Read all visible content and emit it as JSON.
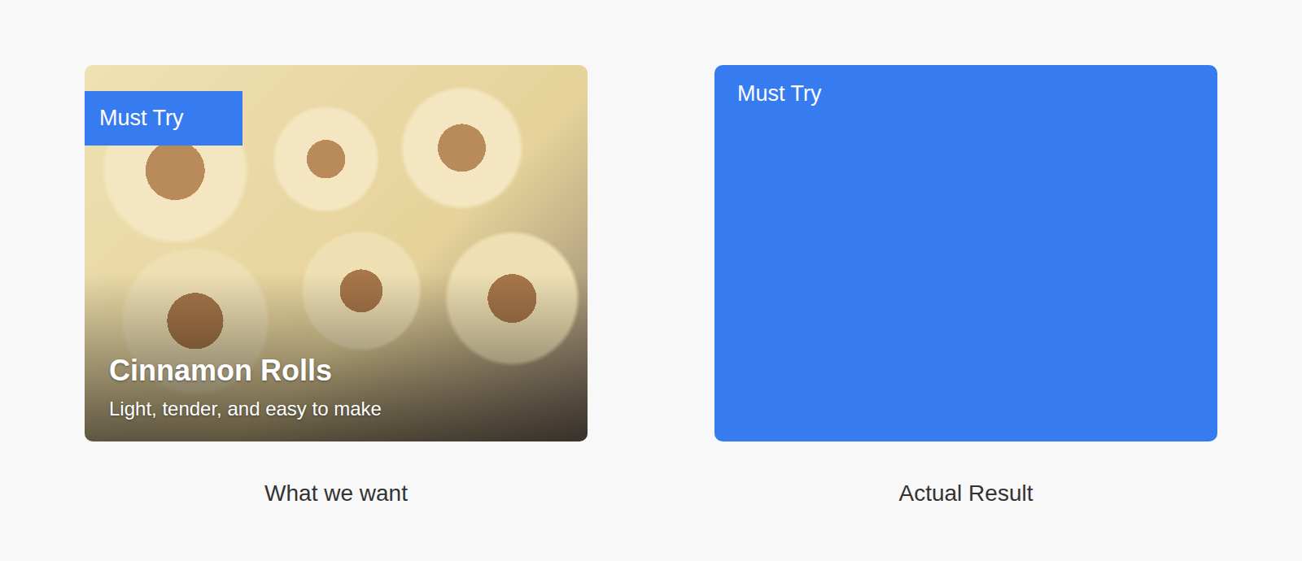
{
  "cards": [
    {
      "kind": "photo",
      "badge": "Must Try",
      "title": "Cinnamon Rolls",
      "subtitle": "Light, tender, and easy to make",
      "caption": "What we want"
    },
    {
      "kind": "plain",
      "badge": "Must Try",
      "caption": "Actual Result"
    }
  ]
}
